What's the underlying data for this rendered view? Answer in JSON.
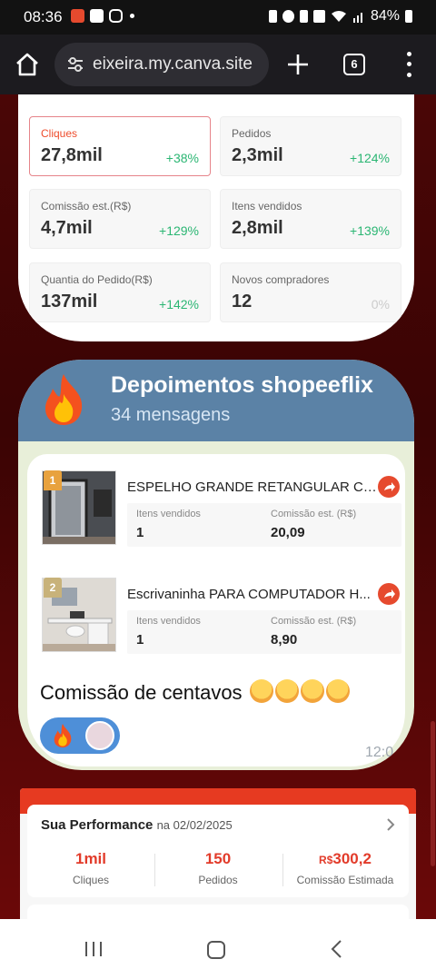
{
  "status_bar": {
    "time": "08:36",
    "battery": "84%"
  },
  "browser": {
    "url": "eixeira.my.canva.site",
    "tab_count": "6"
  },
  "metrics": [
    {
      "label": "Cliques",
      "value": "27,8mil",
      "change": "+38%",
      "active": true
    },
    {
      "label": "Pedidos",
      "value": "2,3mil",
      "change": "+124%"
    },
    {
      "label": "Comissão est.(R$)",
      "value": "4,7mil",
      "change": "+129%"
    },
    {
      "label": "Itens vendidos",
      "value": "2,8mil",
      "change": "+139%"
    },
    {
      "label": "Quantia do Pedido(R$)",
      "value": "137mil",
      "change": "+142%"
    },
    {
      "label": "Novos compradores",
      "value": "12",
      "change": "0%"
    }
  ],
  "testimonial": {
    "title": "Depoimentos shopeeflix",
    "subtitle": "34 mensagens",
    "products": [
      {
        "rank": "1",
        "name": "ESPELHO GRANDE RETANGULAR CO...",
        "items_label": "Itens vendidos",
        "items_value": "1",
        "commission_label": "Comissão est. (R$)",
        "commission_value": "20,09"
      },
      {
        "rank": "2",
        "name": "Escrivaninha PARA COMPUTADOR H...",
        "items_label": "Itens vendidos",
        "items_value": "1",
        "commission_label": "Comissão est. (R$)",
        "commission_value": "8,90"
      }
    ],
    "caption": "Comissão de centavos",
    "time": "12:0"
  },
  "performance": {
    "title": "Sua Performance",
    "date": "na 02/02/2025",
    "stats": [
      {
        "value": "1mil",
        "label": "Cliques"
      },
      {
        "value": "150",
        "label": "Pedidos"
      },
      {
        "currency": "R$",
        "value": "300,2",
        "label": "Comissão Estimada"
      }
    ]
  },
  "colors": {
    "shopee_orange": "#ee4d2d",
    "positive_green": "#2bb673",
    "telegram_blue": "#5b82a6"
  }
}
